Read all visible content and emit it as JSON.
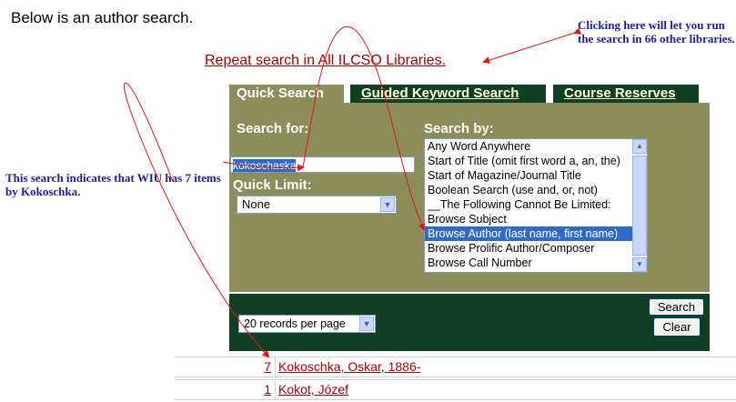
{
  "intro_text": "Below is an author search.",
  "repeat_link": "Repeat search in All ILCSO Libraries.",
  "annotations": {
    "right_note": "Clicking here will let you run the search in 66 other libraries.",
    "left_note": "This search indicates that WIU has 7 items by Kokoschka."
  },
  "tabs": [
    {
      "label": "Quick Search",
      "active": true
    },
    {
      "label": "Guided Keyword Search",
      "active": false
    },
    {
      "label": "Course Reserves",
      "active": false
    }
  ],
  "search_form": {
    "search_for_label": "Search for:",
    "search_value": "kokoschaska",
    "quick_limit_label": "Quick Limit:",
    "quick_limit_value": "None",
    "search_by_label": "Search by:",
    "search_by_options": [
      "Any Word Anywhere",
      "Start of Title (omit first word a, an, the)",
      "Start of Magazine/Journal Title",
      "Boolean Search (use and, or, not)",
      "__The Following Cannot Be Limited:",
      "Browse Subject",
      "Browse Author (last name, first name)",
      "Browse Prolific Author/Composer",
      "Browse Call Number"
    ],
    "search_by_selected": "Browse Author (last name, first name)"
  },
  "controls": {
    "records_per_page": "20 records per page",
    "search_button": "Search",
    "clear_button": "Clear"
  },
  "results": [
    {
      "count": "7",
      "name": "Kokoschka, Oskar, 1886-"
    },
    {
      "count": "1",
      "name": "Kokot, Józef"
    }
  ],
  "colors": {
    "panel_olive": "#8b8d5b",
    "dark_green": "#123f24",
    "link_red": "#990000",
    "note_blue": "#1f1f8f",
    "arrow_red": "#e0191a"
  }
}
